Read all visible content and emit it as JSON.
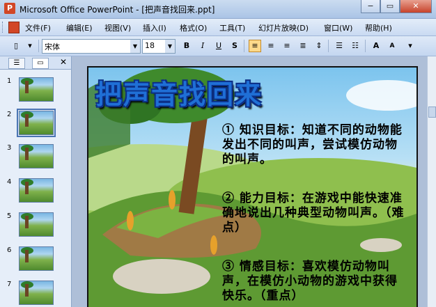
{
  "window": {
    "title": "Microsoft Office PowerPoint - [把声音找回来.ppt]",
    "min": "−",
    "max": "▭",
    "close": "✕"
  },
  "menu": {
    "items": [
      "文件(F)",
      "编辑(E)",
      "视图(V)",
      "插入(I)",
      "格式(O)",
      "工具(T)",
      "幻灯片放映(D)",
      "窗口(W)",
      "帮助(H)"
    ]
  },
  "toolbar": {
    "font_name": "宋体",
    "font_size": "18"
  },
  "slides_panel": {
    "numbers": [
      "1",
      "2",
      "3",
      "4",
      "5",
      "6",
      "7"
    ],
    "selected": 2
  },
  "slide": {
    "title": "把声音找回来",
    "objectives": [
      "① 知识目标：知道不同的动物能发出不同的叫声，尝试模仿动物的叫声。",
      "② 能力目标：在游戏中能快速准确地说出几种典型动物叫声。（难点）",
      "③ 情感目标：喜欢模仿动物叫声，在模仿小动物的游戏中获得快乐。（重点）"
    ]
  },
  "colors": {
    "title_blue": "#1f6fd6",
    "accent": "#d24726"
  }
}
